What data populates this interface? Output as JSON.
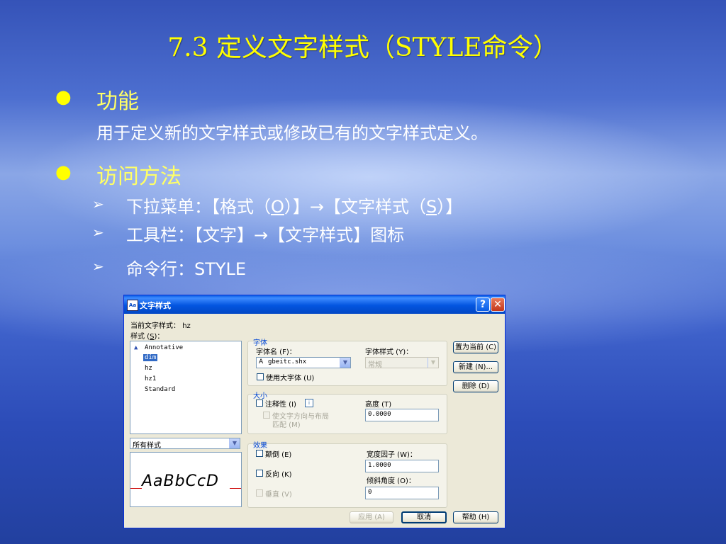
{
  "slide": {
    "title": "7.3 定义文字样式（STYLE命令）",
    "bullets": [
      {
        "heading": "功能",
        "text": "用于定义新的文字样式或修改已有的文字样式定义。"
      },
      {
        "heading": "访问方法"
      }
    ],
    "sub_items": {
      "menu_prefix": "下拉菜单：【格式（",
      "menu_key1": "O",
      "menu_mid": "）】→【文字样式（",
      "menu_key2": "S",
      "menu_suffix": "）】",
      "toolbar": "工具栏：【文字】→【文字样式】图标",
      "command": "命令行：STYLE"
    },
    "arrow_glyph": "➢",
    "bullet_glyph": "●"
  },
  "dialog": {
    "title": "文字样式",
    "help_glyph": "?",
    "close_glyph": "✕",
    "current_style_label": "当前文字样式：",
    "current_style_value": "hz",
    "styles_label": "样式",
    "styles_key": "S",
    "styles": [
      "Annotative",
      "dim",
      "hz",
      "hz1",
      "Standard"
    ],
    "selected_style": "dim",
    "filter_value": "所有样式",
    "preview_text": "AaBbCcD",
    "font_group": "字体",
    "font_name_label": "字体名 (F)：",
    "font_name_value": "gbeitc.shx",
    "font_style_label": "字体样式 (Y)：",
    "font_style_value": "常规",
    "use_bigfont_label": "使用大字体 (U)",
    "size_group": "大小",
    "annotative_label": "注释性 (I)",
    "match_orientation_label_1": "使文字方向与布局",
    "match_orientation_label_2": "匹配 (M)",
    "height_label": "高度 (T)",
    "height_value": "0.0000",
    "effects_group": "效果",
    "upside_down_label": "颠倒 (E)",
    "backwards_label": "反向 (K)",
    "vertical_label": "垂直 (V)",
    "width_factor_label": "宽度因子 (W)：",
    "width_factor_value": "1.0000",
    "oblique_label": "倾斜角度 (O)：",
    "oblique_value": "0",
    "btn_set_current": "置为当前 (C)",
    "btn_new": "新建 (N)...",
    "btn_delete": "删除 (D)",
    "btn_apply": "应用 (A)",
    "btn_cancel": "取消",
    "btn_help": "帮助 (H)"
  }
}
